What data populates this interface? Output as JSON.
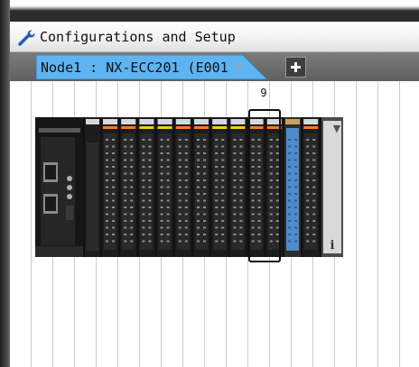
{
  "window": {
    "title": "Configurations and Setup",
    "icon": "wrench-icon"
  },
  "tabs": [
    {
      "label": "Node1 : NX-ECC201 (E001",
      "close_glyph": "✕",
      "active": true
    }
  ],
  "add_tab": {
    "icon": "plus-icon"
  },
  "rack": {
    "selected_slot_label": "9",
    "info_glyph": "i",
    "scroll_glyph": "▼",
    "selected_color": "#4d8cc9"
  },
  "colors": {
    "tab_active": "#5eb4f0",
    "tab_strip": "#6b6b6b",
    "frame": "#2c2c2c",
    "module_led_orange": "#ff7a1a",
    "module_led_yellow": "#f5d000"
  }
}
